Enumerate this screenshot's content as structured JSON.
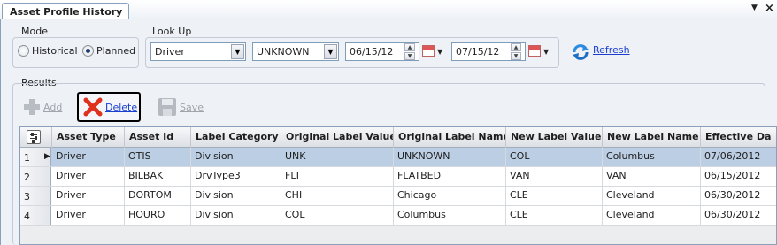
{
  "tab": {
    "title": "Asset Profile History"
  },
  "mode": {
    "label": "Mode",
    "options": [
      {
        "label": "Historical",
        "selected": false
      },
      {
        "label": "Planned",
        "selected": true
      }
    ]
  },
  "lookup": {
    "label": "Look Up",
    "type_value": "Driver",
    "label_value": "UNKNOWN",
    "from_date": "06/15/12",
    "to_date": "07/15/12",
    "refresh_label": "Refresh"
  },
  "results": {
    "label": "Results",
    "toolbar": {
      "add_label": "Add",
      "delete_label": "Delete",
      "save_label": "Save"
    },
    "columns": [
      "Asset Type",
      "Asset Id",
      "Label Category",
      "Original Label Value",
      "Original Label Name",
      "New Label Value",
      "New Label Name",
      "Effective Da"
    ],
    "rows": [
      {
        "num": "1",
        "cells": [
          "Driver",
          "OTIS",
          "Division",
          "UNK",
          "UNKNOWN",
          "COL",
          "Columbus",
          "07/06/2012"
        ],
        "selected": true
      },
      {
        "num": "2",
        "cells": [
          "Driver",
          "BILBAK",
          "DrvType3",
          "FLT",
          "FLATBED",
          "VAN",
          "VAN",
          "06/15/2012"
        ],
        "selected": false
      },
      {
        "num": "3",
        "cells": [
          "Driver",
          "DORTOM",
          "Division",
          "CHI",
          "Chicago",
          "CLE",
          "Cleveland",
          "06/30/2012"
        ],
        "selected": false
      },
      {
        "num": "4",
        "cells": [
          "Driver",
          "HOURO",
          "Division",
          "COL",
          "Columbus",
          "CLE",
          "Cleveland",
          "06/30/2012"
        ],
        "selected": false
      }
    ]
  },
  "colors": {
    "selected_row": "#bccee3",
    "link": "#1a3fd0",
    "delete_red": "#e0301e"
  }
}
